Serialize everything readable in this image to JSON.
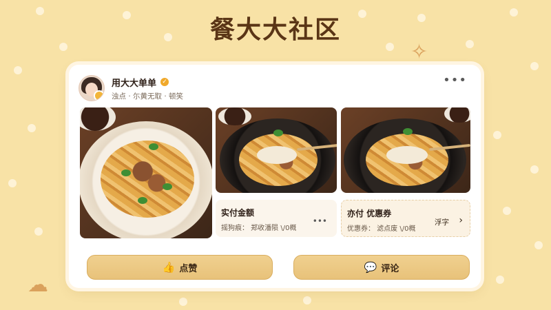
{
  "page_title": "餐大大社区",
  "post": {
    "user_name": "用大大单单",
    "user_sub": "浊点 · 尓黄无取 · 顿笑",
    "more_icon": "more-dots-icon"
  },
  "cards": {
    "card_b": {
      "title": "实付金额",
      "sub": "摇狗痕： 郑收潘陨 \\/0概"
    },
    "card_c": {
      "title": "亦付 优惠券",
      "sub": "优惠券： 滤点废 \\/0概",
      "action": "浮字"
    }
  },
  "buttons": {
    "like_label": "点赞",
    "comment_label": "评论"
  },
  "colors": {
    "background": "#f8e2a6",
    "accent": "#e8c27a",
    "title": "#5a3516"
  }
}
